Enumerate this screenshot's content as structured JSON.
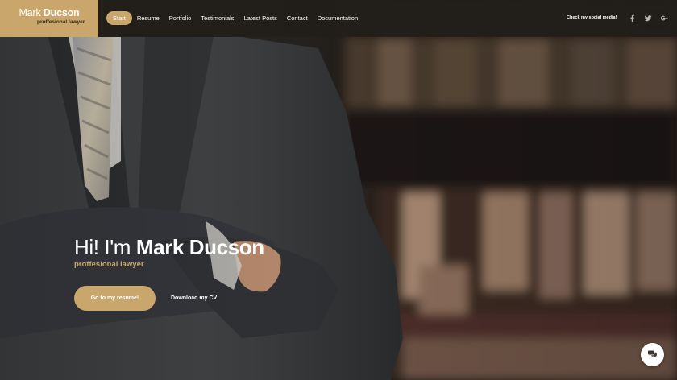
{
  "brand": {
    "first_name": "Mark",
    "last_name": "Ducson",
    "tagline": "proffesional lawyer",
    "color": "#c9a66b"
  },
  "nav": {
    "items": [
      {
        "label": "Start",
        "active": true
      },
      {
        "label": "Resume"
      },
      {
        "label": "Portfolio"
      },
      {
        "label": "Testimonials"
      },
      {
        "label": "Latest Posts"
      },
      {
        "label": "Contact"
      },
      {
        "label": "Documentation"
      }
    ]
  },
  "social": {
    "label": "Check my social media!",
    "icons": [
      "facebook-icon",
      "twitter-icon",
      "google-plus-icon"
    ]
  },
  "hero": {
    "greeting": "Hi! I'm ",
    "name": "Mark Ducson",
    "subtitle": "proffesional lawyer",
    "primary_button": "Go to my resume!",
    "secondary_button": "Download my CV"
  },
  "chat": {
    "icon": "chat-icon"
  },
  "colors": {
    "accent": "#c9a66b",
    "header_bg": "#221e1a"
  }
}
